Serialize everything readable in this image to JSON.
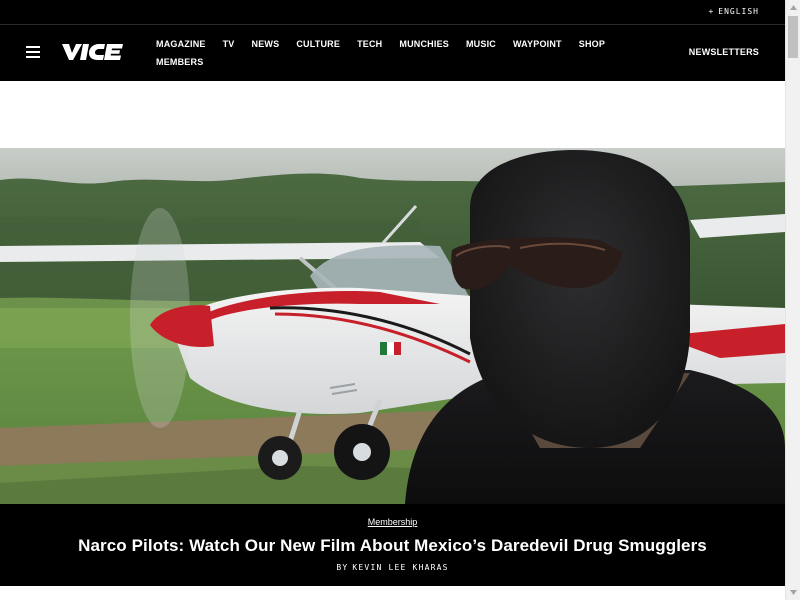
{
  "utility": {
    "language_icon": "plus-icon",
    "language_label": "ENGLISH"
  },
  "nav": {
    "menu_icon": "hamburger-menu-icon",
    "logo_text": "VICE",
    "items": [
      {
        "label": "MAGAZINE"
      },
      {
        "label": "TV"
      },
      {
        "label": "NEWS"
      },
      {
        "label": "CULTURE"
      },
      {
        "label": "TECH"
      },
      {
        "label": "MUNCHIES"
      },
      {
        "label": "MUSIC"
      },
      {
        "label": "WAYPOINT"
      },
      {
        "label": "SHOP"
      },
      {
        "label": "MEMBERS"
      }
    ],
    "newsletters_label": "NEWSLETTERS"
  },
  "hero": {
    "image_subject": "masked man in front of a red and white small propeller airplane on a grassy airstrip"
  },
  "article": {
    "tag": "Membership",
    "headline": "Narco Pilots: Watch Our New Film About Mexico’s Daredevil Drug Smugglers",
    "byline_prefix": "BY",
    "author": "KEVIN LEE KHARAS"
  },
  "colors": {
    "nav_background": "#000000",
    "nav_text": "#ffffff",
    "page_background": "#ffffff",
    "airplane_red": "#c8202a"
  }
}
